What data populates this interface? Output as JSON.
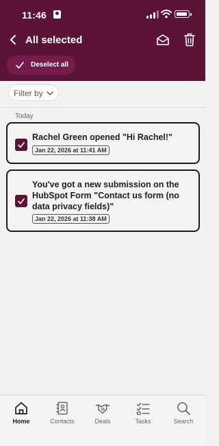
{
  "status_bar": {
    "time": "11:46"
  },
  "nav": {
    "title": "All selected"
  },
  "deselect": {
    "label": "Deselect all"
  },
  "filter": {
    "label": "Filter by"
  },
  "section": {
    "title": "Today"
  },
  "notifications": [
    {
      "text": "Rachel Green opened \"Hi Rachel!\"",
      "timestamp": "Jan 22, 2026 at 11:41 AM",
      "selected": true
    },
    {
      "text": "You've got a new submission on the HubSpot Form \"Contact us form (no data privacy fields)\"",
      "timestamp": "Jan 22, 2026 at 11:38 AM",
      "selected": true
    }
  ],
  "tabs": [
    {
      "label": "Home",
      "icon": "home-icon",
      "active": true
    },
    {
      "label": "Contacts",
      "icon": "contacts-icon",
      "active": false
    },
    {
      "label": "Deals",
      "icon": "handshake-icon",
      "active": false
    },
    {
      "label": "Tasks",
      "icon": "tasks-icon",
      "active": false
    },
    {
      "label": "Search",
      "icon": "search-icon",
      "active": false
    }
  ],
  "colors": {
    "brand": "#5b1437",
    "deselect_pill": "#761c4a",
    "background": "#f2f2f2"
  }
}
